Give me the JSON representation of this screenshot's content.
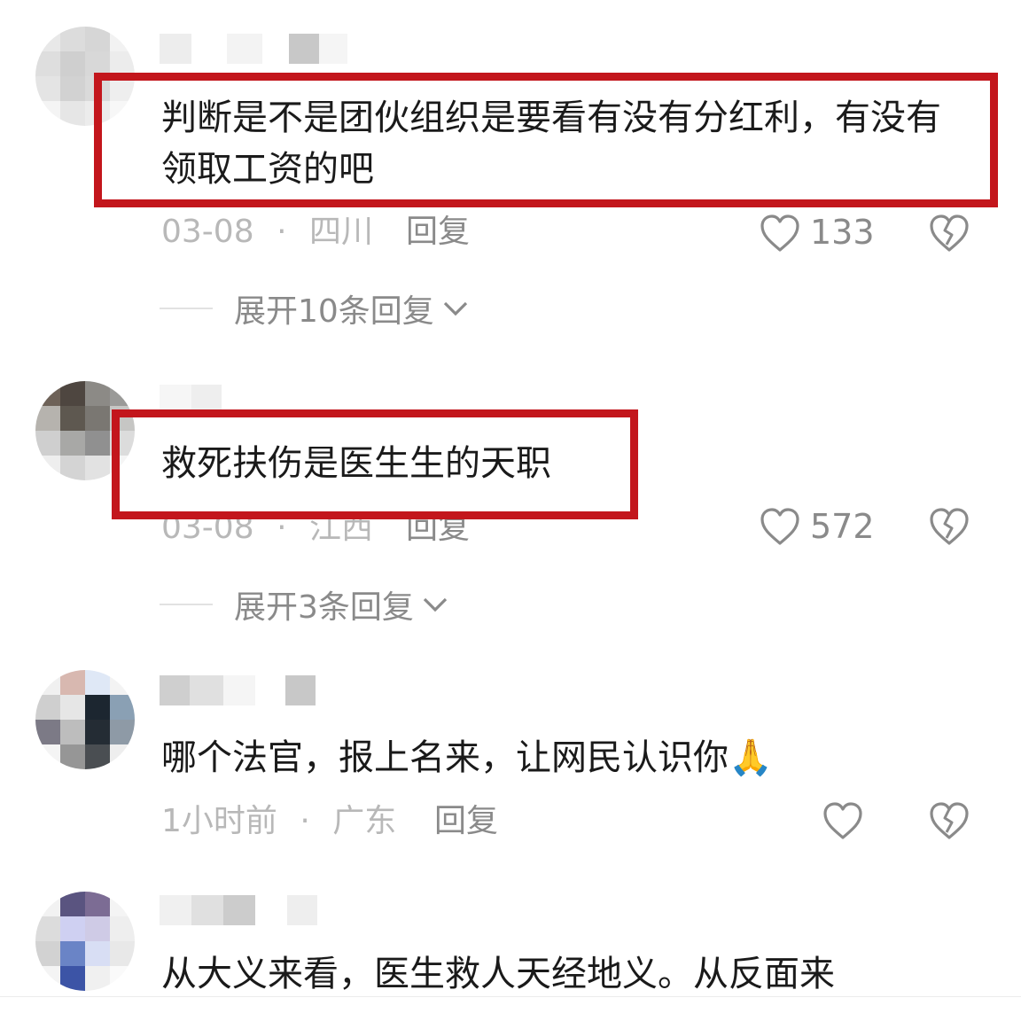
{
  "comments": [
    {
      "text": "判断是不是团伙组织是要看有没有分红利，有没有领取工资的吧",
      "date": "03-08",
      "location": "四川",
      "reply_label": "回复",
      "likes": "133",
      "expand_label": "展开10条回复"
    },
    {
      "text": "救死扶伤是医生生的天职",
      "date": "03-08",
      "location": "江西",
      "reply_label": "回复",
      "likes": "572",
      "expand_label": "展开3条回复"
    },
    {
      "text": "哪个法官，报上名来，让网民认识你🙏",
      "time": "1小时前",
      "location": "广东",
      "reply_label": "回复",
      "likes": ""
    },
    {
      "text": "从大义来看，医生救人天经地义。从反面来"
    }
  ],
  "separator": "·",
  "colors": {
    "highlight_box": "#c3161c",
    "text": "#1a1a1a",
    "meta": "#b8b8b8",
    "action": "#8a8a8a"
  },
  "icons": {
    "like": "heart-outline-icon",
    "dislike": "broken-heart-icon",
    "expand": "chevron-down-icon"
  }
}
